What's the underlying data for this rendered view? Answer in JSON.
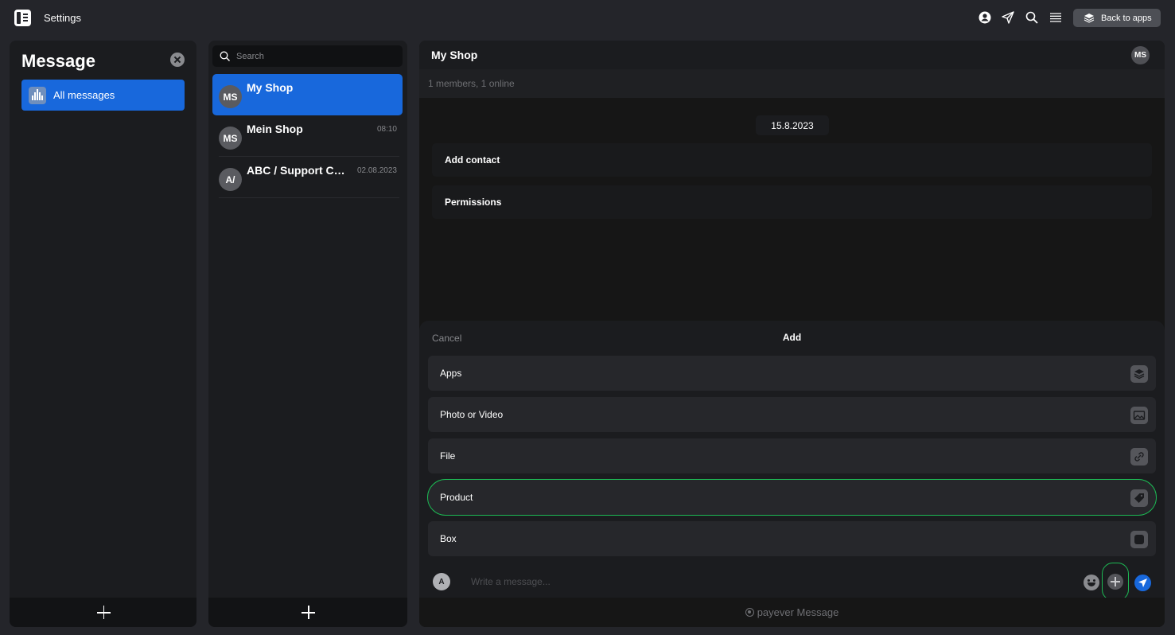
{
  "topbar": {
    "title": "Settings",
    "icons": [
      "profile-icon",
      "send-icon",
      "search-icon",
      "menu-icon"
    ],
    "back_label": "Back to apps"
  },
  "sidebar": {
    "title": "Message",
    "items": [
      {
        "label": "All messages",
        "icon": "waveform-icon"
      }
    ]
  },
  "chat_list": {
    "search_placeholder": "Search",
    "chats": [
      {
        "initials": "MS",
        "name": "My Shop",
        "time": ""
      },
      {
        "initials": "MS",
        "name": "Mein Shop",
        "time": "08:10"
      },
      {
        "initials": "A/",
        "name": "ABC / Support Chat",
        "time": "02.08.2023"
      }
    ]
  },
  "conversation": {
    "title": "My Shop",
    "avatar": "MS",
    "subtitle": "1 members, 1 online",
    "date": "15.8.2023",
    "system_rows": [
      "Add contact",
      "Permissions"
    ]
  },
  "sheet": {
    "cancel": "Cancel",
    "title": "Add",
    "options": [
      {
        "label": "Apps",
        "icon": "layers-icon"
      },
      {
        "label": "Photo or Video",
        "icon": "image-icon"
      },
      {
        "label": "File",
        "icon": "link-icon"
      },
      {
        "label": "Product",
        "icon": "tag-icon"
      },
      {
        "label": "Box",
        "icon": "box-icon"
      }
    ]
  },
  "composer": {
    "avatar": "A",
    "placeholder": "Write a message..."
  },
  "footer": {
    "brand": "payever Message"
  },
  "colors": {
    "accent": "#1868dc",
    "highlight": "#1db954",
    "background": "#24252a"
  }
}
